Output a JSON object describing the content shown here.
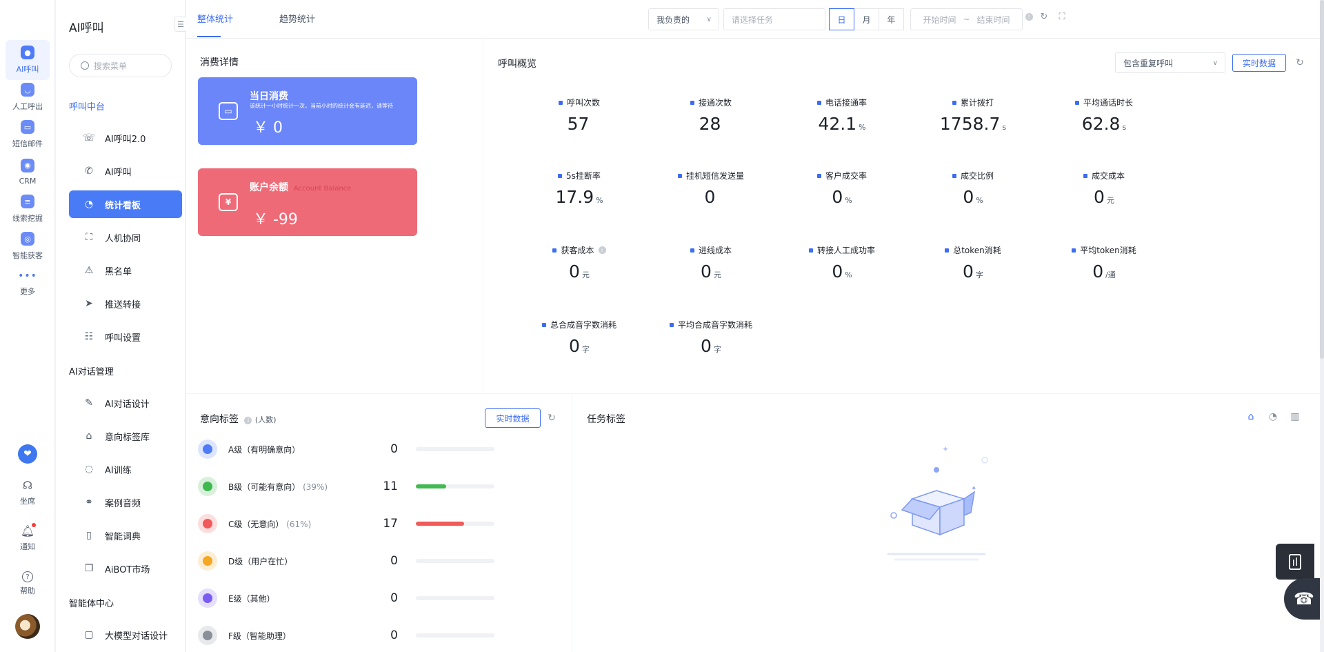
{
  "rail": {
    "items": [
      {
        "label": "AI呼叫",
        "icon": "robot-icon"
      },
      {
        "label": "人工呼出",
        "icon": "phone-out-icon"
      },
      {
        "label": "短信邮件",
        "icon": "message-icon"
      },
      {
        "label": "CRM",
        "icon": "crm-icon"
      },
      {
        "label": "线索挖掘",
        "icon": "clue-icon"
      },
      {
        "label": "智能获客",
        "icon": "acquire-icon"
      },
      {
        "label": "更多",
        "icon": "more-icon"
      }
    ],
    "bottom": [
      {
        "label": "坐席",
        "icon": "headset-icon"
      },
      {
        "label": "通知",
        "icon": "bell-icon"
      },
      {
        "label": "帮助",
        "icon": "help-icon"
      }
    ]
  },
  "menu": {
    "title": "AI呼叫",
    "search_placeholder": "搜索菜单",
    "groups": [
      "呼叫中台",
      "AI对话管理",
      "智能体中心"
    ],
    "items": [
      "AI呼叫2.0",
      "AI呼叫",
      "统计看板",
      "人机协同",
      "黑名单",
      "推送转接",
      "呼叫设置",
      "AI对话设计",
      "意向标签库",
      "AI训练",
      "案例音频",
      "智能词典",
      "AiBOT市场",
      "大模型对话设计"
    ]
  },
  "topbar": {
    "tabs": [
      "整体统计",
      "趋势统计"
    ],
    "owner_select": "我负责的",
    "task_placeholder": "请选择任务",
    "periods": [
      "日",
      "月",
      "年"
    ],
    "start_time": "开始时间",
    "range_sep": "~",
    "end_time": "结束时间"
  },
  "consumption": {
    "title": "消费详情",
    "today": {
      "title": "当日消费",
      "note": "该统计一小时统计一次，当前小时的统计会有延迟，请等待",
      "value": "￥ 0"
    },
    "balance": {
      "title": "账户余额",
      "subtitle": "Account Balance",
      "value": "￥ -99"
    }
  },
  "overview": {
    "title": "呼叫概览",
    "filter": "包含重复呼叫",
    "realtime_label": "实时数据",
    "stats": [
      {
        "label": "呼叫次数",
        "value": "57",
        "unit": ""
      },
      {
        "label": "接通次数",
        "value": "28",
        "unit": ""
      },
      {
        "label": "电话接通率",
        "value": "42.1",
        "unit": "%"
      },
      {
        "label": "累计拨打",
        "value": "1758.7",
        "unit": "s"
      },
      {
        "label": "平均通话时长",
        "value": "62.8",
        "unit": "s"
      },
      {
        "label": "5s挂断率",
        "value": "17.9",
        "unit": "%"
      },
      {
        "label": "挂机短信发送量",
        "value": "0",
        "unit": ""
      },
      {
        "label": "客户成交率",
        "value": "0",
        "unit": "%"
      },
      {
        "label": "成交比例",
        "value": "0",
        "unit": "%"
      },
      {
        "label": "成交成本",
        "value": "0",
        "unit": "元"
      },
      {
        "label": "获客成本",
        "value": "0",
        "unit": "元"
      },
      {
        "label": "进线成本",
        "value": "0",
        "unit": "元"
      },
      {
        "label": "转接人工成功率",
        "value": "0",
        "unit": "%"
      },
      {
        "label": "总token消耗",
        "value": "0",
        "unit": "字"
      },
      {
        "label": "平均token消耗",
        "value": "0",
        "unit": "/通"
      },
      {
        "label": "总合成音字数消耗",
        "value": "0",
        "unit": "字"
      },
      {
        "label": "平均合成音字数消耗",
        "value": "0",
        "unit": "字"
      }
    ]
  },
  "intent": {
    "title": "意向标签",
    "unit_note": "(人数)",
    "realtime_label": "实时数据",
    "rows": [
      {
        "label": "A级（有明确意向）",
        "pct": "",
        "count": "0",
        "fraction": 0,
        "color": "#4f7cf6"
      },
      {
        "label": "B级（可能有意向）",
        "pct": "(39%)",
        "count": "11",
        "fraction": 0.39,
        "color": "#3fb950"
      },
      {
        "label": "C级（无意向）",
        "pct": "(61%)",
        "count": "17",
        "fraction": 0.61,
        "color": "#f05a5a"
      },
      {
        "label": "D级（用户在忙）",
        "pct": "",
        "count": "0",
        "fraction": 0,
        "color": "#f5a623"
      },
      {
        "label": "E级（其他）",
        "pct": "",
        "count": "0",
        "fraction": 0,
        "color": "#7b5cf0"
      },
      {
        "label": "F级（智能助理）",
        "pct": "",
        "count": "0",
        "fraction": 0,
        "color": "#8a8f99"
      }
    ]
  },
  "task_tags": {
    "title": "任务标签"
  },
  "colors": {
    "accent": "#3d6df2",
    "card_blue": "#6b86f8",
    "card_red": "#ee6a77"
  }
}
